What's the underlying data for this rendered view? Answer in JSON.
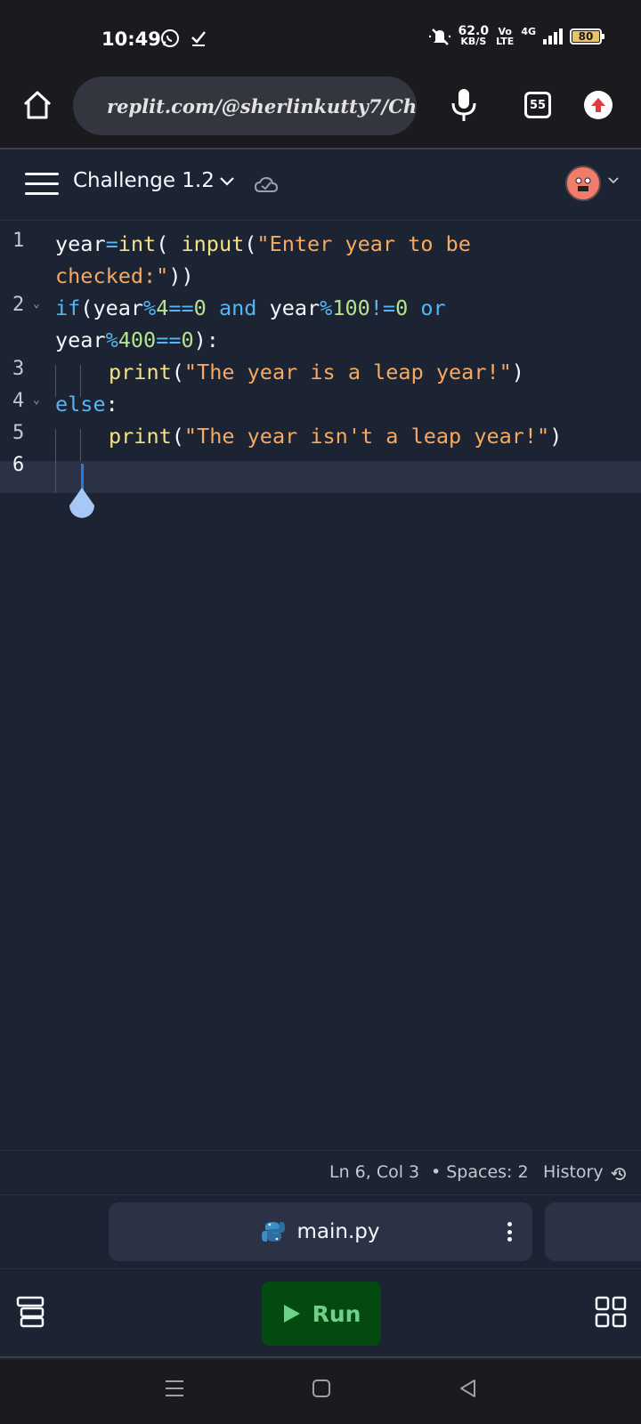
{
  "status_bar": {
    "time": "10:49",
    "net_speed_value": "62.0",
    "net_speed_unit": "KB/S",
    "volte_top": "Vo",
    "volte_bottom": "LTE",
    "network": "4G",
    "battery": "80",
    "icons": [
      "whatsapp-icon",
      "check-icon",
      "mute-icon",
      "signal-icon",
      "battery-icon"
    ]
  },
  "browser": {
    "url": "replit.com/@sherlinkutty7/Ch",
    "tab_count": "55",
    "icons": [
      "home-icon",
      "lock-icon",
      "microphone-icon",
      "tabs-icon",
      "update-icon"
    ]
  },
  "app_header": {
    "title": "Challenge 1.2",
    "icons": [
      "menu-icon",
      "chevron-down-icon",
      "cloud-check-icon",
      "avatar",
      "chevron-down-icon"
    ]
  },
  "editor": {
    "lines": [
      {
        "number": "1",
        "fold": ""
      },
      {
        "number": "2",
        "fold": "⌄"
      },
      {
        "number": "3",
        "fold": ""
      },
      {
        "number": "4",
        "fold": "⌄"
      },
      {
        "number": "5",
        "fold": ""
      },
      {
        "number": "6",
        "fold": ""
      }
    ],
    "tokens": {
      "l1a_var": "year",
      "l1a_op": "=",
      "l1a_fn1": "int",
      "l1a_p1": "(",
      "l1a_sp": " ",
      "l1a_fn2": "input",
      "l1a_p2": "(",
      "l1a_str": "\"Enter year to be",
      "l1b_str": "checked:\"",
      "l1b_p": "))",
      "l2a_kw": "if",
      "l2a_p": "(",
      "l2a_var1": "year",
      "l2a_op1": "%",
      "l2a_num1": "4",
      "l2a_op2": "==",
      "l2a_num2": "0",
      "l2a_and": " and ",
      "l2a_var2": "year",
      "l2a_op3": "%",
      "l2a_num3": "100",
      "l2a_op4": "!=",
      "l2a_num4": "0",
      "l2a_or": " or",
      "l2b_var": "year",
      "l2b_op1": "%",
      "l2b_num1": "400",
      "l2b_op2": "==",
      "l2b_num2": "0",
      "l2b_p": "):",
      "l3_fn": "print",
      "l3_p1": "(",
      "l3_str": "\"The year is a leap year!\"",
      "l3_p2": ")",
      "l4_kw": "else",
      "l4_p": ":",
      "l5_fn": "print",
      "l5_p1": "(",
      "l5_str": "\"The year isn't a leap year!\"",
      "l5_p2": ")"
    },
    "colors": {
      "keyword": "#56b6f5",
      "function": "#f2e18a",
      "string": "#f5a962",
      "number": "#b5e38d",
      "background": "#1c2333"
    }
  },
  "status_line": {
    "position": "Ln 6, Col 3",
    "spaces": "Spaces: 2",
    "history": "History",
    "icons": [
      "history-icon"
    ]
  },
  "file_tabs": [
    {
      "name": "main.py",
      "icon": "python-icon"
    }
  ],
  "bottom_bar": {
    "run_label": "Run",
    "run_color": "#044a10",
    "icons": [
      "stack-icon",
      "play-icon",
      "grid-icon"
    ]
  },
  "nav_bar": {
    "icons": [
      "recents-icon",
      "home-nav-icon",
      "back-icon"
    ]
  }
}
